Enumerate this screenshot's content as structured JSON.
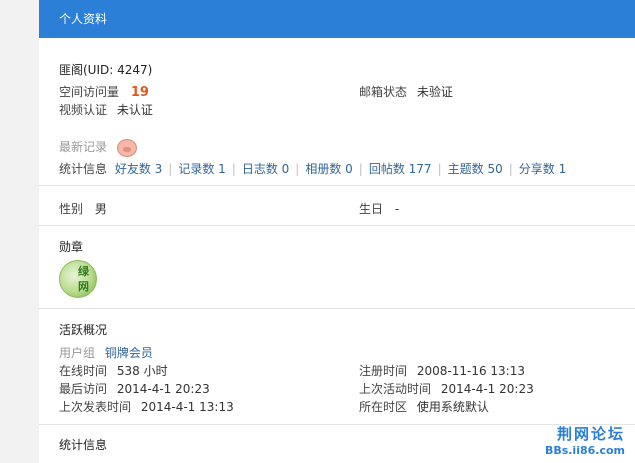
{
  "header": {
    "title": "个人资料"
  },
  "profile": {
    "name_uid": "匪阁(UID: 4247)"
  },
  "space_visits": {
    "label": "空间访问量",
    "value": "19"
  },
  "email_status": {
    "label": "邮箱状态",
    "value": "未验证"
  },
  "video_verify": {
    "label": "视频认证",
    "value": "未认证"
  },
  "recent": {
    "label": "最新记录"
  },
  "stats": {
    "label": "统计信息",
    "items": [
      "好友数 3",
      "记录数 1",
      "日志数 0",
      "相册数 0",
      "回帖数 177",
      "主题数 50",
      "分享数 1"
    ]
  },
  "gender": {
    "label": "性别",
    "value": "男"
  },
  "birthday": {
    "label": "生日",
    "value": "-"
  },
  "medals": {
    "title": "勋章",
    "medal_text_1": "绿",
    "medal_text_2": "网"
  },
  "activity": {
    "title": "活跃概况",
    "usergroup_label": "用户组",
    "usergroup_value": "铜牌会员",
    "online_label": "在线时间",
    "online_value": "538 小时",
    "reg_label": "注册时间",
    "reg_value": "2008-11-16 13:13",
    "last_visit_label": "最后访问",
    "last_visit_value": "2014-4-1 20:23",
    "last_active_label": "上次活动时间",
    "last_active_value": "2014-4-1 20:23",
    "last_post_label": "上次发表时间",
    "last_post_value": "2014-4-1 13:13",
    "timezone_label": "所在时区",
    "timezone_value": "使用系统默认"
  },
  "stats_section": {
    "title": "统计信息"
  },
  "watermark": {
    "cn": "荆网论坛",
    "url": "BBs.ii86.com"
  }
}
